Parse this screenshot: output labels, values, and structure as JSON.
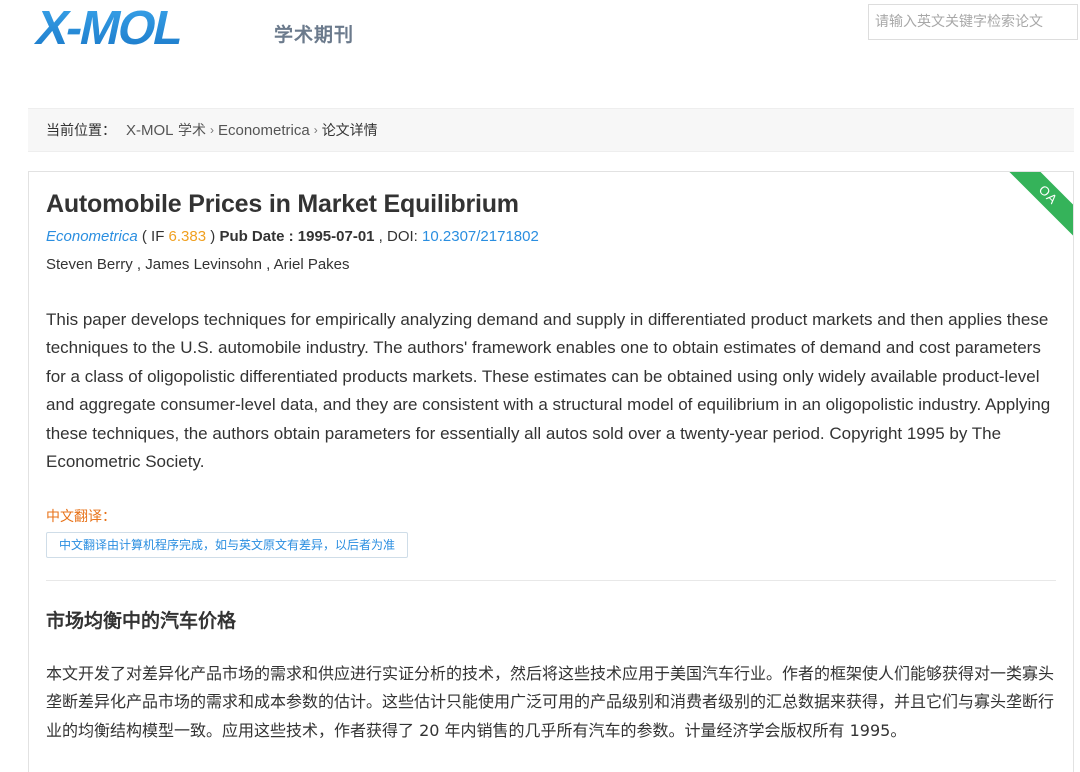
{
  "header": {
    "logo_text": "X-MOL",
    "logo_subtitle": "学术期刊",
    "search_placeholder": "请输入英文关键字检索论文"
  },
  "breadcrumb": {
    "label": "当前位置：",
    "items": [
      {
        "label_prefix": "X-MOL",
        "label_suffix": " 学术"
      },
      {
        "label": "Econometrica"
      },
      {
        "label": "论文详情"
      }
    ],
    "separator": "›"
  },
  "article": {
    "oa_badge": "OA",
    "title": "Automobile Prices in Market Equilibrium",
    "journal": "Econometrica",
    "if_open": " ( IF ",
    "if_value": "6.383",
    "if_close": " ) ",
    "pub_date_label": "Pub Date : ",
    "pub_date": "1995-07-01",
    "doi_label": " , DOI: ",
    "doi": "10.2307/2171802",
    "authors": [
      "Steven Berry",
      "James Levinsohn",
      "Ariel Pakes"
    ],
    "author_sep": " , ",
    "abstract": "This paper develops techniques for empirically analyzing demand and supply in differentiated product markets and then applies these techniques to the U.S. automobile industry. The authors' framework enables one to obtain estimates of demand and cost parameters for a class of oligopolistic differentiated products markets. These estimates can be obtained using only widely available product-level and aggregate consumer-level data, and they are consistent with a structural model of equilibrium in an oligopolistic industry. Applying these techniques, the authors obtain parameters for essentially all autos sold over a twenty-year period. Copyright 1995 by The Econometric Society.",
    "translation_label": "中文翻译：",
    "translation_note": "中文翻译由计算机程序完成，如与英文原文有差异，以后者为准",
    "cn_title": "市场均衡中的汽车价格",
    "cn_abstract": "本文开发了对差异化产品市场的需求和供应进行实证分析的技术，然后将这些技术应用于美国汽车行业。作者的框架使人们能够获得对一类寡头垄断差异化产品市场的需求和成本参数的估计。这些估计只能使用广泛可用的产品级别和消费者级别的汇总数据来获得，并且它们与寡头垄断行业的均衡结构模型一致。应用这些技术，作者获得了 20 年内销售的几乎所有汽车的参数。计量经济学会版权所有 1995。"
  },
  "colors": {
    "logo_blue": "#2a8fd8",
    "link_blue": "#2a8ee0",
    "if_orange": "#f0a020",
    "translation_orange": "#e8731a",
    "oa_green": "#35b35a"
  }
}
